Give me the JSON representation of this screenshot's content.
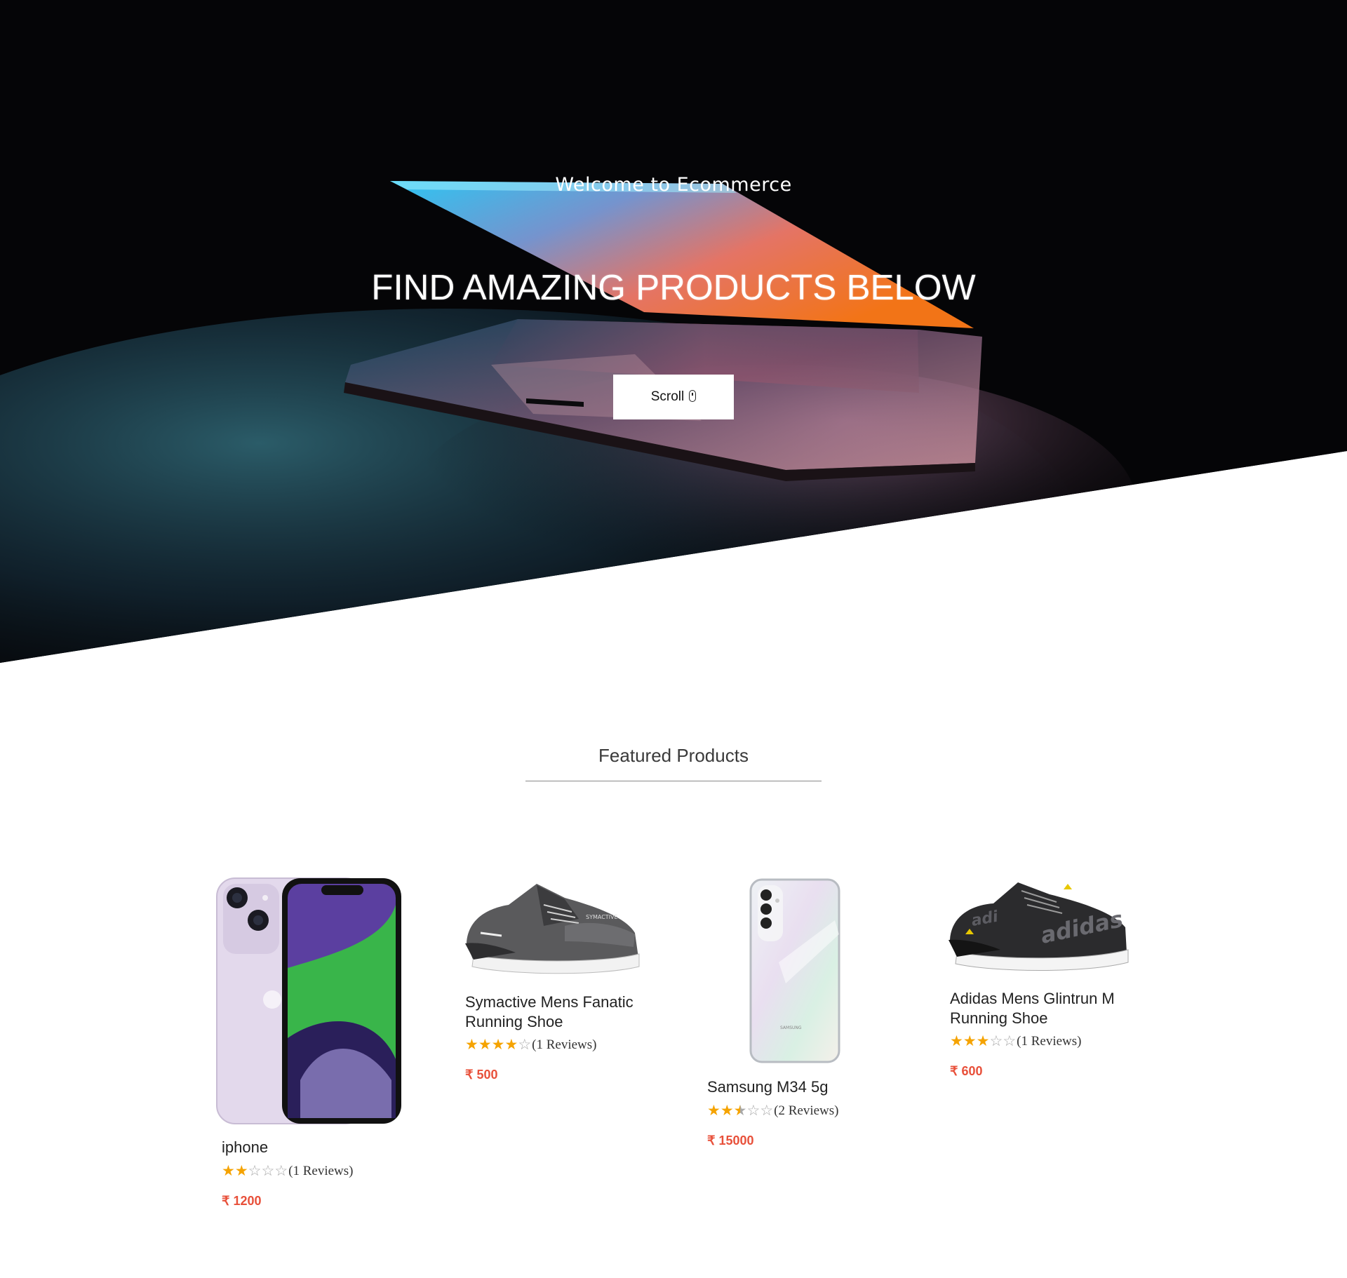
{
  "hero": {
    "welcome_text": "Welcome to Ecommerce",
    "heading": "FIND AMAZING PRODUCTS BELOW",
    "scroll_label": "Scroll",
    "scroll_icon": "mouse-icon"
  },
  "featured": {
    "title": "Featured Products"
  },
  "products": [
    {
      "name": "iphone",
      "rating": 2,
      "reviews": "(1 Reviews)",
      "price": "₹ 1200",
      "image": "iphone-image"
    },
    {
      "name": "Symactive Mens Fanatic Running Shoe",
      "rating": 4,
      "reviews": "(1 Reviews)",
      "price": "₹ 500",
      "image": "grey-running-shoe-image"
    },
    {
      "name": "Samsung M34 5g",
      "rating": 2.5,
      "reviews": "(2 Reviews)",
      "price": "₹ 15000",
      "image": "samsung-phone-image"
    },
    {
      "name": "Adidas Mens Glintrun M Running Shoe",
      "rating": 3,
      "reviews": "(1 Reviews)",
      "price": "₹ 600",
      "image": "adidas-shoe-image"
    }
  ],
  "colors": {
    "price": "#e8503a",
    "star": "#f5a300",
    "hero_bg": "#050507"
  }
}
